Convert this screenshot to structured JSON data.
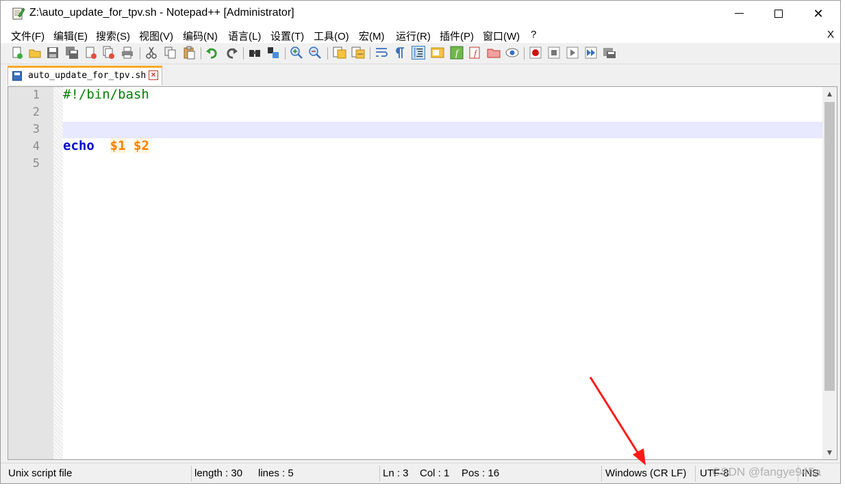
{
  "window": {
    "title": "Z:\\auto_update_for_tpv.sh - Notepad++ [Administrator]",
    "controls": {
      "minimize": "",
      "maximize": "",
      "close": "✕"
    }
  },
  "menubar": {
    "items": [
      "文件(F)",
      "编辑(E)",
      "搜索(S)",
      "视图(V)",
      "编码(N)",
      "语言(L)",
      "设置(T)",
      "工具(O)",
      "宏(M)",
      "运行(R)",
      "插件(P)",
      "窗口(W)",
      "?"
    ],
    "close_label": "X"
  },
  "toolbar": {
    "icons": [
      "new-file-icon",
      "open-file-icon",
      "save-icon",
      "save-all-icon",
      "close-icon",
      "close-all-icon",
      "print-icon",
      "cut-icon",
      "copy-icon",
      "paste-icon",
      "undo-icon",
      "redo-icon",
      "find-icon",
      "replace-icon",
      "zoom-in-icon",
      "zoom-out-icon",
      "sync-vertical-icon",
      "sync-horizontal-icon",
      "word-wrap-icon",
      "show-all-chars-icon",
      "indent-guide-icon",
      "doc-map-icon",
      "function-list-icon",
      "folder-workspace-icon",
      "doc-list-icon",
      "monitoring-icon",
      "record-macro-icon",
      "stop-macro-icon",
      "play-macro-icon",
      "run-macro-multiple-icon",
      "save-macro-icon"
    ]
  },
  "tab": {
    "label": "auto_update_for_tpv.sh",
    "close": "×"
  },
  "editor": {
    "line_numbers": [
      "1",
      "2",
      "3",
      "4",
      "5"
    ],
    "current_line": 3,
    "lines": {
      "shebang": "#!/bin/bash",
      "keyword": "echo",
      "var1": "$1",
      "var2": "$2"
    }
  },
  "statusbar": {
    "filetype": "Unix script file",
    "length": "length : 30",
    "lines": "lines : 5",
    "ln": "Ln : 3",
    "col": "Col : 1",
    "pos": "Pos : 16",
    "eol": "Windows (CR LF)",
    "encoding": "UTF-8",
    "mode": "INS"
  },
  "watermark": "CSDN @fangye945a",
  "colors": {
    "tab_accent": "#f9a825",
    "current_line": "#e8e8ff",
    "keyword": "#0000cc",
    "variable": "#ff7f00",
    "comment": "#007f00",
    "annotation_arrow": "#ff1a1a"
  }
}
